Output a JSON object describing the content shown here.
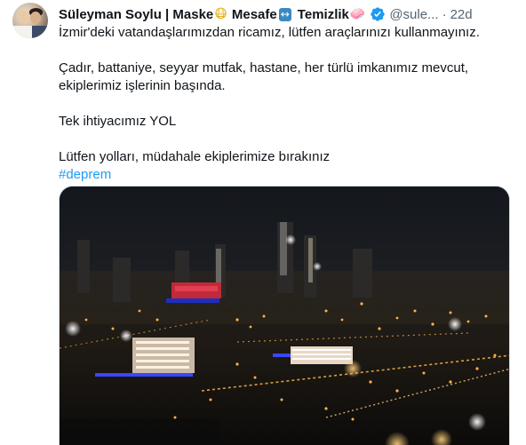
{
  "tweet": {
    "author": {
      "name": "Süleyman Soylu | Maske",
      "emoji_mask": "😷",
      "name_mesafe": "Mesafe",
      "emoji_arrows": "↔",
      "name_temizlik": "Temizlik",
      "emoji_soap": "🧼",
      "handle": "@sule...",
      "verified": true,
      "avatar_icon": "profile-photo"
    },
    "separator": "·",
    "time": "22d",
    "text": {
      "line1": "İzmir'deki vatandaşlarımızdan ricamız, lütfen araçlarınızı kullanmayınız.",
      "line2": "Çadır, battaniye, seyyar mutfak, hastane, her türlü imkanımız mevcut,",
      "line3": "ekiplerimiz işlerinin başında.",
      "line4": "Tek ihtiyacımız YOL",
      "line5": "Lütfen yolları, müdahale ekiplerimize bırakınız",
      "hashtag": "#deprem"
    },
    "media": {
      "type": "video",
      "description_icon": "night-city-video"
    },
    "colors": {
      "link": "#1d9bf0",
      "muted": "#536471",
      "verified": "#1d9bf0"
    }
  }
}
